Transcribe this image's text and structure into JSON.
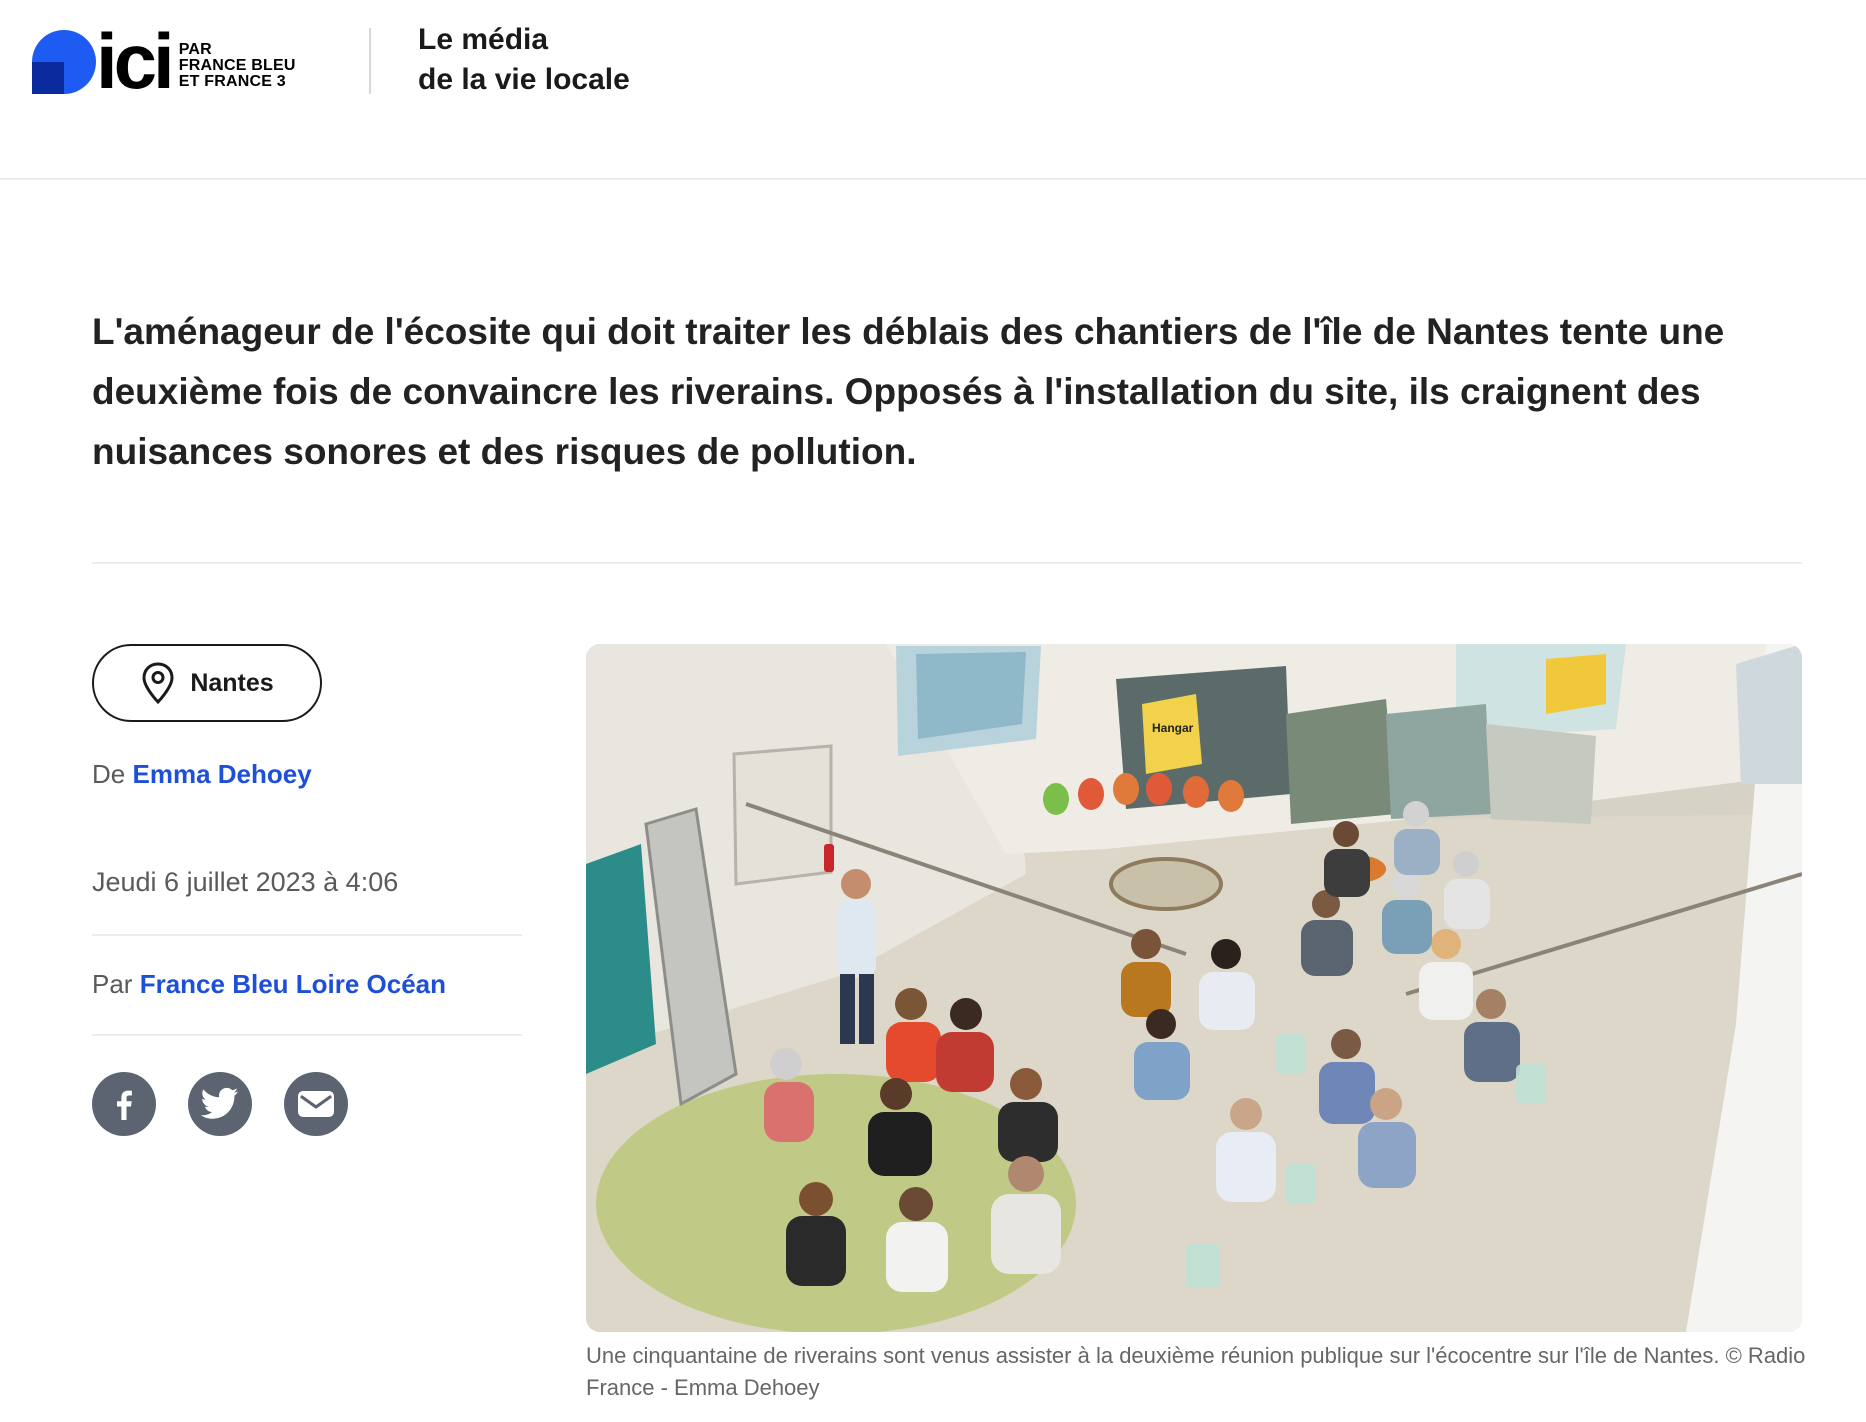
{
  "brand": {
    "logo_word": "ici",
    "logo_sub": [
      "PAR",
      "FRANCE BLEU",
      "ET FRANCE 3"
    ],
    "tagline_line1": "Le média",
    "tagline_line2": "de la vie locale",
    "primary_color": "#1d5bf2"
  },
  "article": {
    "chapo": "L'aménageur de l'écosite qui doit traiter les déblais des chantiers de l'île de Nantes tente une deuxième fois de convaincre les riverains. Opposés à l'installation du site, ils craignent des nuisances sonores et des risques de pollution.",
    "location": "Nantes",
    "author_prefix": "De",
    "author_name": "Emma Dehoey",
    "date": "Jeudi 6 juillet 2023 à 4:06",
    "source_prefix": "Par",
    "source_name": "France Bleu Loire Océan",
    "link_color": "#1d4fd8",
    "caption": "Une cinquantaine de riverains sont venus assister à la deuxième réunion publique sur l'écocentre sur l'île de Nantes. © Radio France - Emma Dehoey"
  },
  "share": {
    "icons": [
      "facebook-icon",
      "twitter-icon",
      "email-icon"
    ],
    "icon_bg": "#5b6470"
  },
  "photo": {
    "poster_label": "Hangar"
  }
}
